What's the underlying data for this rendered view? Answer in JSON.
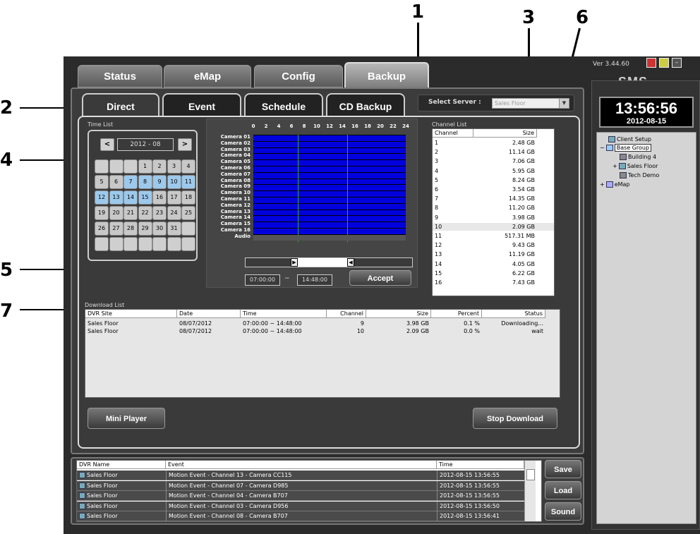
{
  "callouts": [
    "1",
    "2",
    "3",
    "4",
    "5",
    "6",
    "7"
  ],
  "version": "Ver 3.44.60",
  "brand": "SMS",
  "clock": {
    "time": "13:56:56",
    "date": "2012-08-15"
  },
  "top_tabs": [
    "Status",
    "eMap",
    "Config",
    "Backup"
  ],
  "sub_tabs": [
    "Direct",
    "Event",
    "Schedule",
    "CD Backup"
  ],
  "select_server": {
    "label": "Select Server :",
    "value": "Sales Floor"
  },
  "time_list": {
    "label": "Time List",
    "prev": "<",
    "next": ">",
    "month": "2012 - 08",
    "weeks": [
      [
        "",
        "",
        "",
        "1",
        "2",
        "3",
        "4"
      ],
      [
        "5",
        "6",
        "7",
        "8",
        "9",
        "10",
        "11"
      ],
      [
        "12",
        "13",
        "14",
        "15",
        "16",
        "17",
        "18"
      ],
      [
        "19",
        "20",
        "21",
        "22",
        "23",
        "24",
        "25"
      ],
      [
        "26",
        "27",
        "28",
        "29",
        "30",
        "31",
        ""
      ],
      [
        "",
        "",
        "",
        "",
        "",
        "",
        ""
      ]
    ],
    "highlighted": [
      "7",
      "8",
      "9",
      "10",
      "11",
      "12",
      "13",
      "14",
      "15"
    ]
  },
  "timeline": {
    "hours": [
      "0",
      "2",
      "4",
      "6",
      "8",
      "10",
      "12",
      "14",
      "16",
      "18",
      "20",
      "22",
      "24"
    ],
    "cameras": [
      "Camera 01",
      "Camera 02",
      "Camera 03",
      "Camera 04",
      "Camera 05",
      "Camera 06",
      "Camera 07",
      "Camera 08",
      "Camera 09",
      "Camera 10",
      "Camera 11",
      "Camera 12",
      "Camera 13",
      "Camera 14",
      "Camera 15",
      "Camera 16",
      "Audio"
    ],
    "start": "07:00:00",
    "tilde": "~",
    "end": "14:48:00",
    "accept": "Accept"
  },
  "channel_list": {
    "label": "Channel List",
    "headers": [
      "Channel",
      "Size"
    ],
    "rows": [
      [
        "1",
        "2.48 GB"
      ],
      [
        "2",
        "11.14 GB"
      ],
      [
        "3",
        "7.06 GB"
      ],
      [
        "4",
        "5.95 GB"
      ],
      [
        "5",
        "8.24 GB"
      ],
      [
        "6",
        "3.54 GB"
      ],
      [
        "7",
        "14.35 GB"
      ],
      [
        "8",
        "11.20 GB"
      ],
      [
        "9",
        "3.98 GB"
      ],
      [
        "10",
        "2.09 GB"
      ],
      [
        "11",
        "517.31 MB"
      ],
      [
        "12",
        "9.43 GB"
      ],
      [
        "13",
        "11.19 GB"
      ],
      [
        "14",
        "4.05 GB"
      ],
      [
        "15",
        "6.22 GB"
      ],
      [
        "16",
        "7.43 GB"
      ]
    ]
  },
  "download_list": {
    "label": "Download List",
    "headers": [
      "DVR Site",
      "Date",
      "Time",
      "Channel",
      "Size",
      "Percent",
      "Status"
    ],
    "rows": [
      [
        "Sales Floor",
        "08/07/2012",
        "07:00:00 ~ 14:48:00",
        "9",
        "3.98 GB",
        "0.1 %",
        "Downloading..."
      ],
      [
        "Sales Floor",
        "08/07/2012",
        "07:00:00 ~ 14:48:00",
        "10",
        "2.09 GB",
        "0.0 %",
        "wait"
      ]
    ]
  },
  "buttons": {
    "mini_player": "Mini Player",
    "stop_download": "Stop Download",
    "save": "Save",
    "load": "Load",
    "sound": "Sound"
  },
  "tree": {
    "items": [
      "Client Setup",
      "Base Group",
      "Building 4",
      "Sales Floor",
      "Tech Demo",
      "eMap"
    ]
  },
  "events": {
    "headers": [
      "DVR Name",
      "Event",
      "Time"
    ],
    "rows": [
      [
        "Sales Floor",
        "Motion Event  -  Channel 13  -  Camera CC115",
        "2012-08-15 13:56:55"
      ],
      [
        "Sales Floor",
        "Motion Event  -  Channel 07  -  Camera D985",
        "2012-08-15 13:56:55"
      ],
      [
        "Sales Floor",
        "Motion Event  -  Channel 04  -  Camera B707",
        "2012-08-15 13:56:55"
      ],
      [
        "Sales Floor",
        "Motion Event  -  Channel 03  -  Camera D956",
        "2012-08-15 13:56:50"
      ],
      [
        "Sales Floor",
        "Motion Event  -  Channel 08  -  Camera B707",
        "2012-08-15 13:56:41"
      ]
    ]
  }
}
